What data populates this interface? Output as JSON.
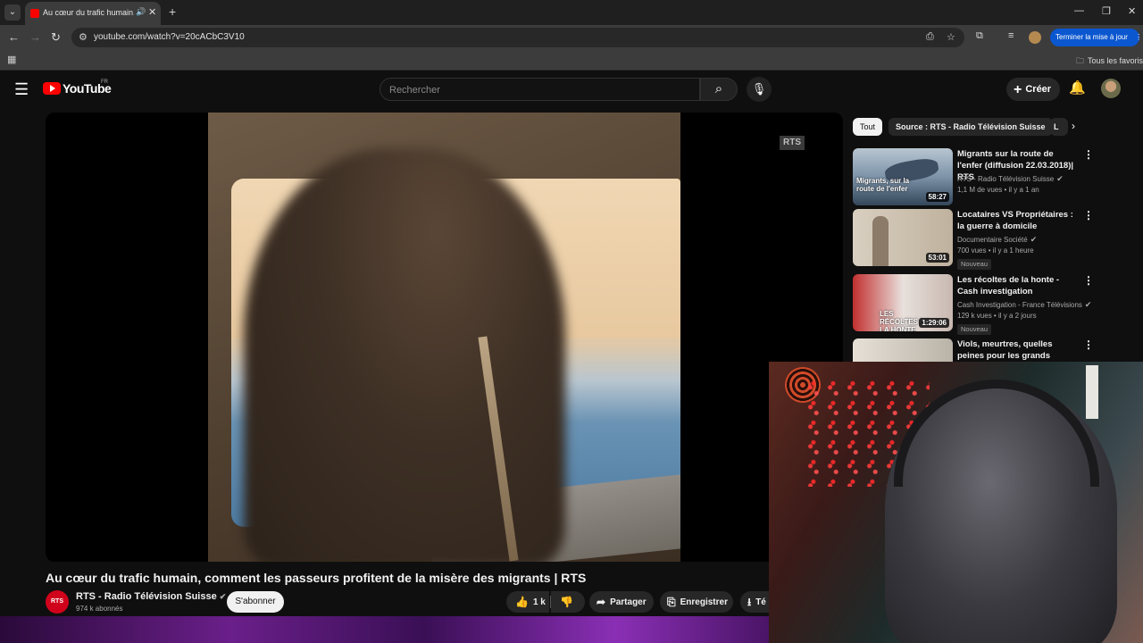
{
  "browser": {
    "tab_title": "Au cœur du trafic humain, c",
    "tab_audio_icon": "speaker-icon",
    "url": "youtube.com/watch?v=20cACbC3V10",
    "update_button": "Terminer la mise à jour",
    "all_bookmarks": "Tous les favoris"
  },
  "masthead": {
    "logo_text": "YouTube",
    "country_code": "FR",
    "search_placeholder": "Rechercher",
    "create_label": "Créer"
  },
  "player": {
    "watermark": "RTS"
  },
  "video": {
    "title": "Au cœur du trafic humain, comment les passeurs profitent de la misère des migrants | RTS",
    "channel_avatar": "RTS",
    "channel_name": "RTS - Radio Télévision Suisse",
    "subscribers": "974 k abonnés",
    "subscribe_label": "S'abonner",
    "likes": "1 k",
    "share_label": "Partager",
    "save_label": "Enregistrer",
    "download_label": "Té"
  },
  "sidebar": {
    "chips": [
      "Tout",
      "Source : RTS - Radio Télévision Suisse",
      "L"
    ],
    "recommendations": [
      {
        "title": "Migrants sur la route de l'enfer (diffusion 22.03.2018)| RTS",
        "channel": "RTS - Radio Télévision Suisse",
        "meta": "1,1 M de vues • il y a 1 an",
        "duration": "58:27",
        "thumb_text": "Migrants, sur la route de l'enfer",
        "badge": ""
      },
      {
        "title": "Locataires VS Propriétaires : la guerre à domicile",
        "channel": "Documentaire Société",
        "meta": "700 vues • il y a 1 heure",
        "duration": "53:01",
        "thumb_text": "",
        "badge": "Nouveau"
      },
      {
        "title": "Les récoltes de la honte - Cash investigation",
        "channel": "Cash Investigation - France Télévisions",
        "meta": "129 k vues • il y a 2 jours",
        "duration": "1:29:06",
        "thumb_text": "LES RÉCOLTES DE LA HONTE",
        "badge": "Nouveau"
      },
      {
        "title": "Viols, meurtres, quelles peines pour les grands assassins ? | ...",
        "channel": "",
        "meta": "",
        "duration": "",
        "thumb_text": "",
        "badge": ""
      }
    ]
  },
  "colors": {
    "background": "#0f0f0f",
    "youtube_red": "#ff0000",
    "update_blue": "#0b57d0",
    "pill_gray": "#272727"
  }
}
